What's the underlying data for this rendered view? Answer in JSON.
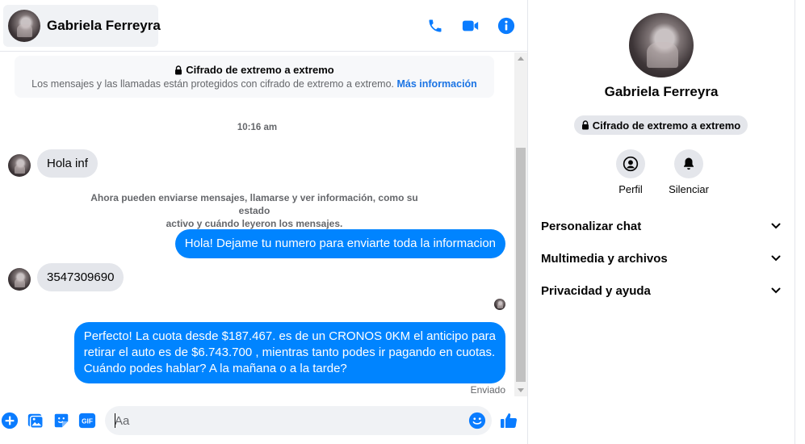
{
  "header": {
    "contact_name": "Gabriela Ferreyra",
    "icons": [
      "phone-icon",
      "video-camera-icon",
      "info-icon"
    ]
  },
  "encryption_banner": {
    "title": "Cifrado de extremo a extremo",
    "subtitle": "Los mensajes y las llamadas están protegidos con cifrado de extremo a extremo.",
    "link": "Más información"
  },
  "conversation": {
    "timestamp": "10:16 am",
    "messages": [
      {
        "direction": "in",
        "text": "Hola inf"
      },
      {
        "direction": "system",
        "lines": [
          "Ahora pueden enviarse mensajes, llamarse y ver información, como su estado",
          "activo y cuándo leyeron los mensajes."
        ]
      },
      {
        "direction": "out",
        "text": "Hola! Dejame tu numero  para enviarte toda la informacion"
      },
      {
        "direction": "in",
        "text": "3547309690"
      },
      {
        "direction": "out",
        "lines": [
          "Perfecto! La cuota desde $187.467. es de un CRONOS 0KM el anticipo para",
          "retirar el auto es de $6.743.700 , mientras tanto podes ir pagando en cuotas.",
          "Cuándo podes hablar? A la mañana o a la tarde?"
        ]
      }
    ],
    "status": "Enviado"
  },
  "composer": {
    "placeholder": "Aa",
    "icons": [
      "plus-circle-icon",
      "photo-icon",
      "sticker-icon",
      "gif-icon",
      "emoji-icon",
      "thumbs-up-icon"
    ],
    "gif_label": "GIF"
  },
  "info_panel": {
    "name": "Gabriela Ferreyra",
    "encryption_pill": "Cifrado de extremo a extremo",
    "actions": [
      {
        "label": "Perfil",
        "icon": "profile-icon"
      },
      {
        "label": "Silenciar",
        "icon": "bell-icon"
      }
    ],
    "sections": [
      {
        "label": "Personalizar chat"
      },
      {
        "label": "Multimedia y archivos"
      },
      {
        "label": "Privacidad y ayuda"
      }
    ]
  },
  "colors": {
    "accent": "#0084ff",
    "icon_blue": "#0a7cff",
    "incoming_bubble": "#e4e6eb",
    "link": "#1b74e4",
    "muted_text": "#65676b"
  }
}
